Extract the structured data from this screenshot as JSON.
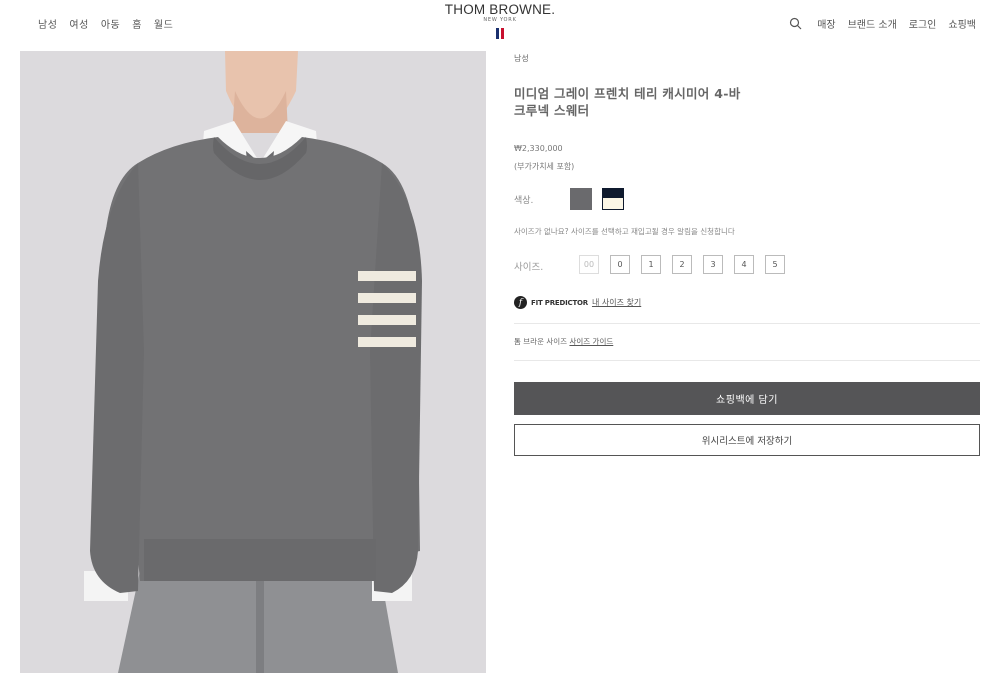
{
  "nav": {
    "left": [
      "남성",
      "여성",
      "아동",
      "홈",
      "월드"
    ],
    "right": [
      "매장",
      "브랜드 소개",
      "로그인",
      "쇼핑백"
    ],
    "search_icon": "search-icon"
  },
  "logo": {
    "main": "THOM BROWNE.",
    "sub": "NEW YORK",
    "flag_colors": [
      "#1a2f6e",
      "#ffffff",
      "#c8102e"
    ]
  },
  "product": {
    "category": "남성",
    "title": "미디엄 그레이 프렌치 테리 캐시미어 4-바 크루넥 스웨터",
    "price": "₩2,330,000",
    "vat": "(부가가치세 포함)",
    "color_label": "색상.",
    "colors": [
      "#6a6a6d",
      "#0f1a2e"
    ],
    "size_notify": "사이즈가 없나요? 사이즈를 선택하고 재입고될 경우 알림을 신청합니다",
    "size_label": "사이즈.",
    "sizes": [
      "00",
      "0",
      "1",
      "2",
      "3",
      "4",
      "5"
    ],
    "fit_brand": "FIT PREDICTOR",
    "fit_link": "내 사이즈 찾기",
    "size_guide_prefix": "톰 브라운 사이즈",
    "size_guide_link": "사이즈 가이드",
    "add_to_bag": "쇼핑백에 담기",
    "wishlist": "위시리스트에 저장하기"
  }
}
